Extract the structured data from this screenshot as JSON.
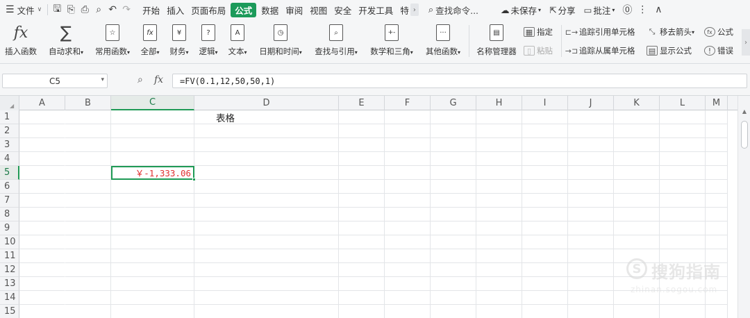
{
  "menubar": {
    "menu_label": "文件",
    "tabs": [
      "开始",
      "插入",
      "页面布局",
      "公式",
      "数据",
      "审阅",
      "视图",
      "安全",
      "开发工具",
      "特"
    ],
    "active_tab": "公式",
    "search_placeholder": "查找命令...",
    "unsaved_label": "未保存",
    "share_label": "分享",
    "comment_label": "批注"
  },
  "ribbon": {
    "insert_function": "插入函数",
    "autosum": "自动求和",
    "common_functions": "常用函数",
    "all": "全部",
    "finance": "财务",
    "logic": "逻辑",
    "text": "文本",
    "datetime": "日期和时间",
    "lookup": "查找与引用",
    "math": "数学和三角",
    "other": "其他函数",
    "name_manager": "名称管理器",
    "define": "指定",
    "paste": "粘贴",
    "trace_precedents": "追踪引用单元格",
    "trace_dependents": "追踪从属单元格",
    "remove_arrows": "移去箭头",
    "show_formulas": "显示公式",
    "formula_menu": "公式",
    "error_check": "错误",
    "fx_glyph": "fx",
    "sum_glyph": "∑"
  },
  "formulabar": {
    "cell_ref": "C5",
    "fx_label": "fx",
    "formula": "=FV(0.1,12,50,50,1)"
  },
  "sheet": {
    "columns": [
      "A",
      "B",
      "C",
      "D",
      "E",
      "F",
      "G",
      "H",
      "I",
      "J",
      "K",
      "L",
      "M"
    ],
    "selected_column": "C",
    "row_numbers": [
      "1",
      "2",
      "3",
      "4",
      "5",
      "6",
      "7",
      "8",
      "9",
      "10",
      "11",
      "12",
      "13",
      "14",
      "15"
    ],
    "selected_row": "5",
    "title_cell_text": "表格",
    "active_cell_value": "￥-1,333.06",
    "active_cell_color": "#e03030"
  },
  "watermark": {
    "brand": "搜狗指南",
    "url": "zhinan.sogou.com"
  },
  "colors": {
    "accent_green": "#1c9a5a",
    "toolbar_bg": "#f5f6f7"
  }
}
